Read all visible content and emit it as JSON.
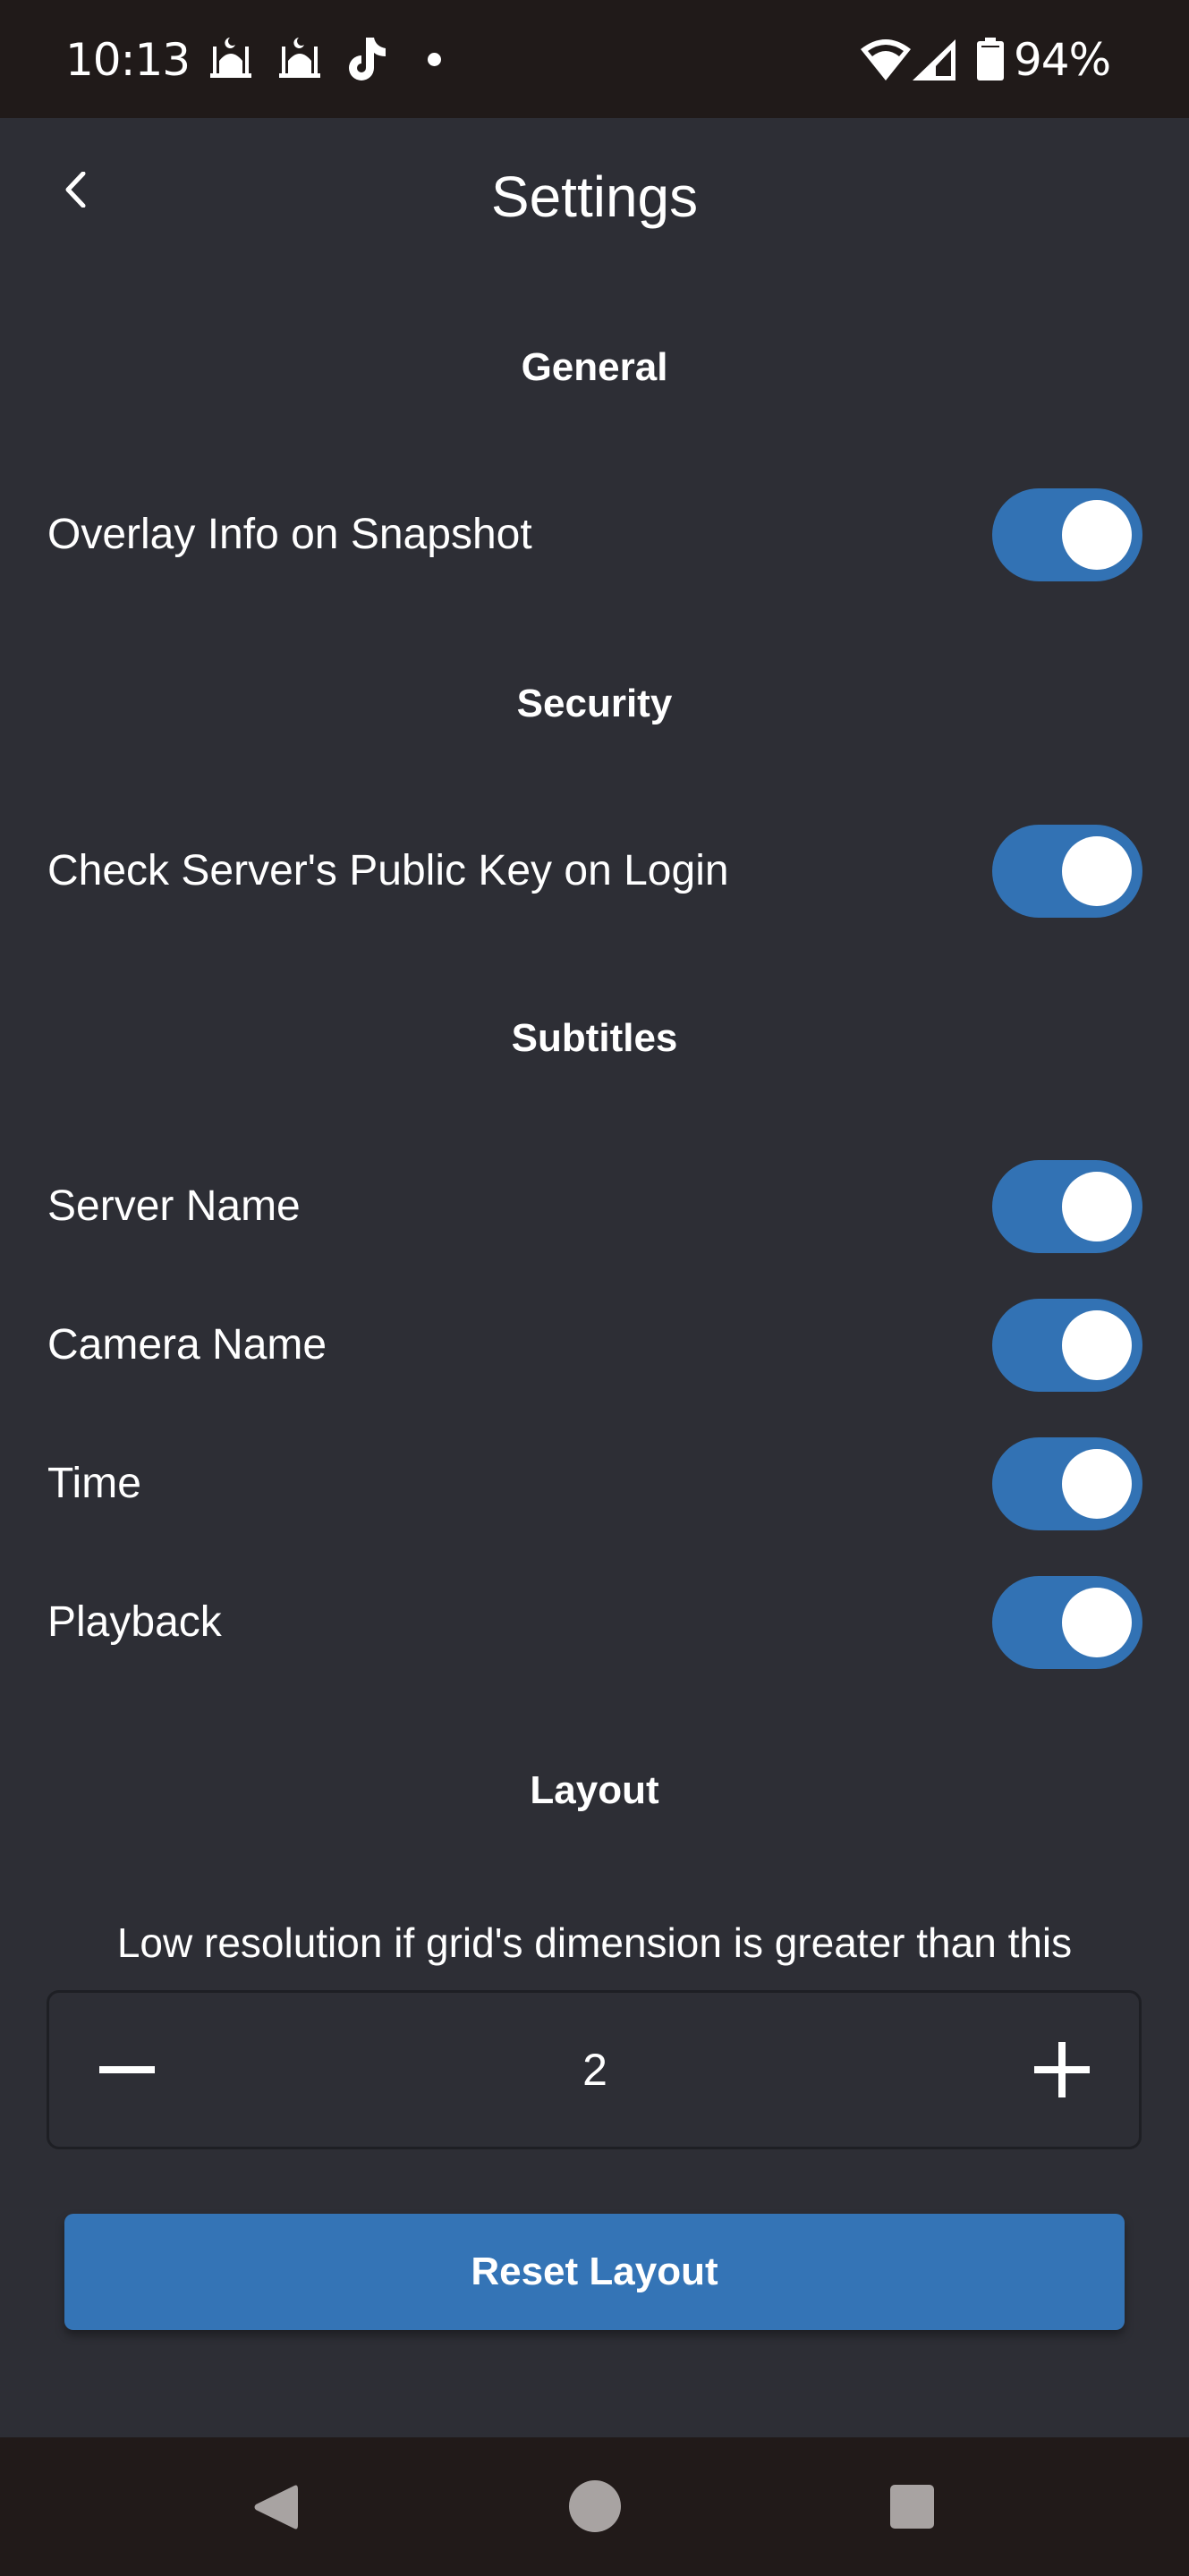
{
  "status_bar": {
    "time": "10:13",
    "notification_icons": [
      "mosque-icon",
      "mosque-icon",
      "tiktok-icon",
      "dot-icon"
    ],
    "system_icons": [
      "wifi-icon",
      "signal-icon",
      "battery-icon"
    ],
    "battery_percent": "94%"
  },
  "header": {
    "back_icon": "chevron-left-icon",
    "title": "Settings"
  },
  "sections": {
    "general": {
      "title": "General",
      "items": [
        {
          "label": "Overlay Info on Snapshot",
          "enabled": true
        }
      ]
    },
    "security": {
      "title": "Security",
      "items": [
        {
          "label": "Check Server's Public Key on Login",
          "enabled": true
        }
      ]
    },
    "subtitles": {
      "title": "Subtitles",
      "items": [
        {
          "label": "Server Name",
          "enabled": true
        },
        {
          "label": "Camera Name",
          "enabled": true
        },
        {
          "label": "Time",
          "enabled": true
        },
        {
          "label": "Playback",
          "enabled": true
        }
      ]
    },
    "layout": {
      "title": "Layout",
      "lowres_label": "Low resolution if grid's dimension is greater than this",
      "stepper": {
        "value": "2",
        "decrement_icon": "minus-icon",
        "increment_icon": "plus-icon"
      },
      "reset_button_label": "Reset Layout"
    }
  },
  "nav_bar": {
    "buttons": [
      "back-triangle-icon",
      "home-circle-icon",
      "recents-square-icon"
    ]
  },
  "colors": {
    "background": "#2d2e35",
    "accent": "#3272b4",
    "button": "#3474b6",
    "system_bars": "#201a19"
  }
}
